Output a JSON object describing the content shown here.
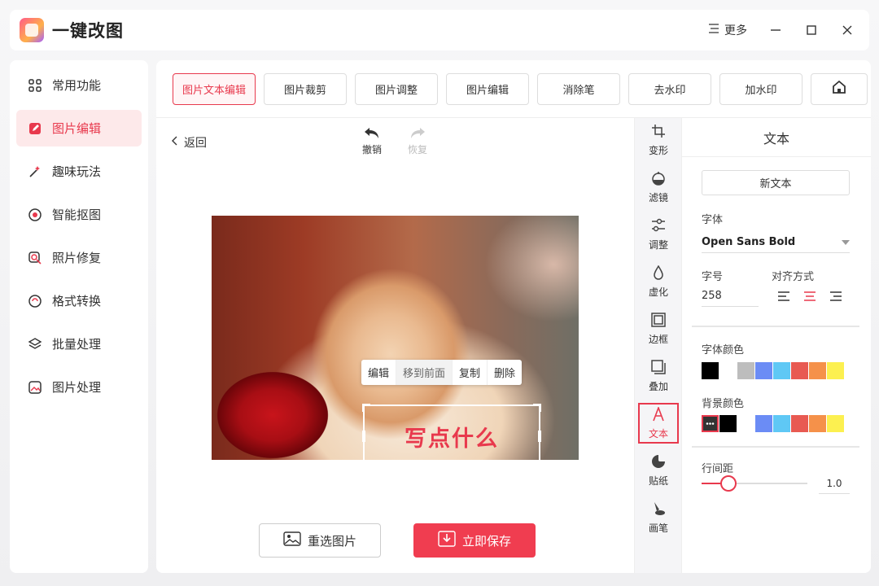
{
  "app": {
    "title": "一键改图",
    "more_label": "更多"
  },
  "sidebar": {
    "items": [
      {
        "label": "常用功能",
        "icon": "grid-icon"
      },
      {
        "label": "图片编辑",
        "icon": "edit-icon"
      },
      {
        "label": "趣味玩法",
        "icon": "magic-icon"
      },
      {
        "label": "智能抠图",
        "icon": "target-icon"
      },
      {
        "label": "照片修复",
        "icon": "repair-icon"
      },
      {
        "label": "格式转换",
        "icon": "convert-icon"
      },
      {
        "label": "批量处理",
        "icon": "layers-icon"
      },
      {
        "label": "图片处理",
        "icon": "image-icon"
      }
    ]
  },
  "tabs": [
    "图片文本编辑",
    "图片裁剪",
    "图片调整",
    "图片编辑",
    "消除笔",
    "去水印",
    "加水印"
  ],
  "toolbar": {
    "back_label": "返回",
    "undo_label": "撤销",
    "redo_label": "恢复"
  },
  "popup_menu": [
    "编辑",
    "移到前面",
    "复制",
    "删除"
  ],
  "canvas_text": "写点什么",
  "actions": {
    "reselect_label": "重选图片",
    "save_label": "立即保存"
  },
  "tools": [
    {
      "label": "变形",
      "icon": "crop-icon"
    },
    {
      "label": "滤镜",
      "icon": "filter-icon"
    },
    {
      "label": "调整",
      "icon": "adjust-icon"
    },
    {
      "label": "虚化",
      "icon": "blur-icon"
    },
    {
      "label": "边框",
      "icon": "frame-icon"
    },
    {
      "label": "叠加",
      "icon": "overlay-icon"
    },
    {
      "label": "文本",
      "icon": "text-icon"
    },
    {
      "label": "贴纸",
      "icon": "sticker-icon"
    },
    {
      "label": "画笔",
      "icon": "brush-icon"
    }
  ],
  "props": {
    "title": "文本",
    "new_text_label": "新文本",
    "font_label": "字体",
    "font_value": "Open Sans Bold",
    "size_label": "字号",
    "size_value": "258",
    "align_label": "对齐方式",
    "font_color_label": "字体颜色",
    "bg_color_label": "背景颜色",
    "line_spacing_label": "行间距",
    "line_spacing_value": "1.0",
    "line_spacing_fraction": 0.25,
    "font_colors": [
      "#000000",
      "#ffffff",
      "#bdbdbd",
      "#6b8cf5",
      "#5fc8f5",
      "#e85a52",
      "#f5914a",
      "#fcf050"
    ],
    "bg_colors": [
      "#333333",
      "#000000",
      "#ffffff",
      "#6b8cf5",
      "#5fc8f5",
      "#e85a52",
      "#f5914a",
      "#fcf050"
    ]
  },
  "accent_color": "#e8394d"
}
